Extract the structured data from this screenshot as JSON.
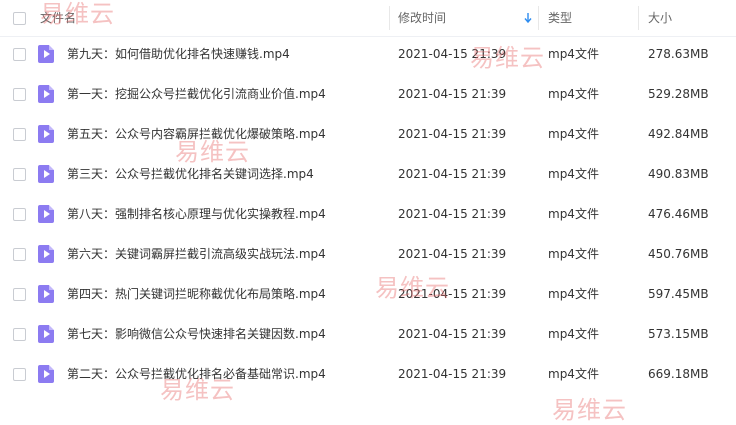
{
  "header": {
    "name": "文件名",
    "modified": "修改时间",
    "type": "类型",
    "size": "大小"
  },
  "files": [
    {
      "name": "第九天：如何借助优化排名快速赚钱.mp4",
      "modified": "2021-04-15 21:39",
      "type": "mp4文件",
      "size": "278.63MB"
    },
    {
      "name": "第一天：挖掘公众号拦截优化引流商业价值.mp4",
      "modified": "2021-04-15 21:39",
      "type": "mp4文件",
      "size": "529.28MB"
    },
    {
      "name": "第五天：公众号内容霸屏拦截优化爆破策略.mp4",
      "modified": "2021-04-15 21:39",
      "type": "mp4文件",
      "size": "492.84MB"
    },
    {
      "name": "第三天：公众号拦截优化排名关键词选择.mp4",
      "modified": "2021-04-15 21:39",
      "type": "mp4文件",
      "size": "490.83MB"
    },
    {
      "name": "第八天：强制排名核心原理与优化实操教程.mp4",
      "modified": "2021-04-15 21:39",
      "type": "mp4文件",
      "size": "476.46MB"
    },
    {
      "name": "第六天：关键词霸屏拦截引流高级实战玩法.mp4",
      "modified": "2021-04-15 21:39",
      "type": "mp4文件",
      "size": "450.76MB"
    },
    {
      "name": "第四天：热门关键词拦昵称截优化布局策略.mp4",
      "modified": "2021-04-15 21:39",
      "type": "mp4文件",
      "size": "597.45MB"
    },
    {
      "name": "第七天：影响微信公众号快速排名关键因数.mp4",
      "modified": "2021-04-15 21:39",
      "type": "mp4文件",
      "size": "573.15MB"
    },
    {
      "name": "第二天：公众号拦截优化排名必备基础常识.mp4",
      "modified": "2021-04-15 21:39",
      "type": "mp4文件",
      "size": "669.18MB"
    }
  ],
  "watermark": "易维云",
  "colors": {
    "file_icon": "#8c7bf1",
    "sort_arrow": "#2d8cf0",
    "watermark": "#e86e6e"
  }
}
